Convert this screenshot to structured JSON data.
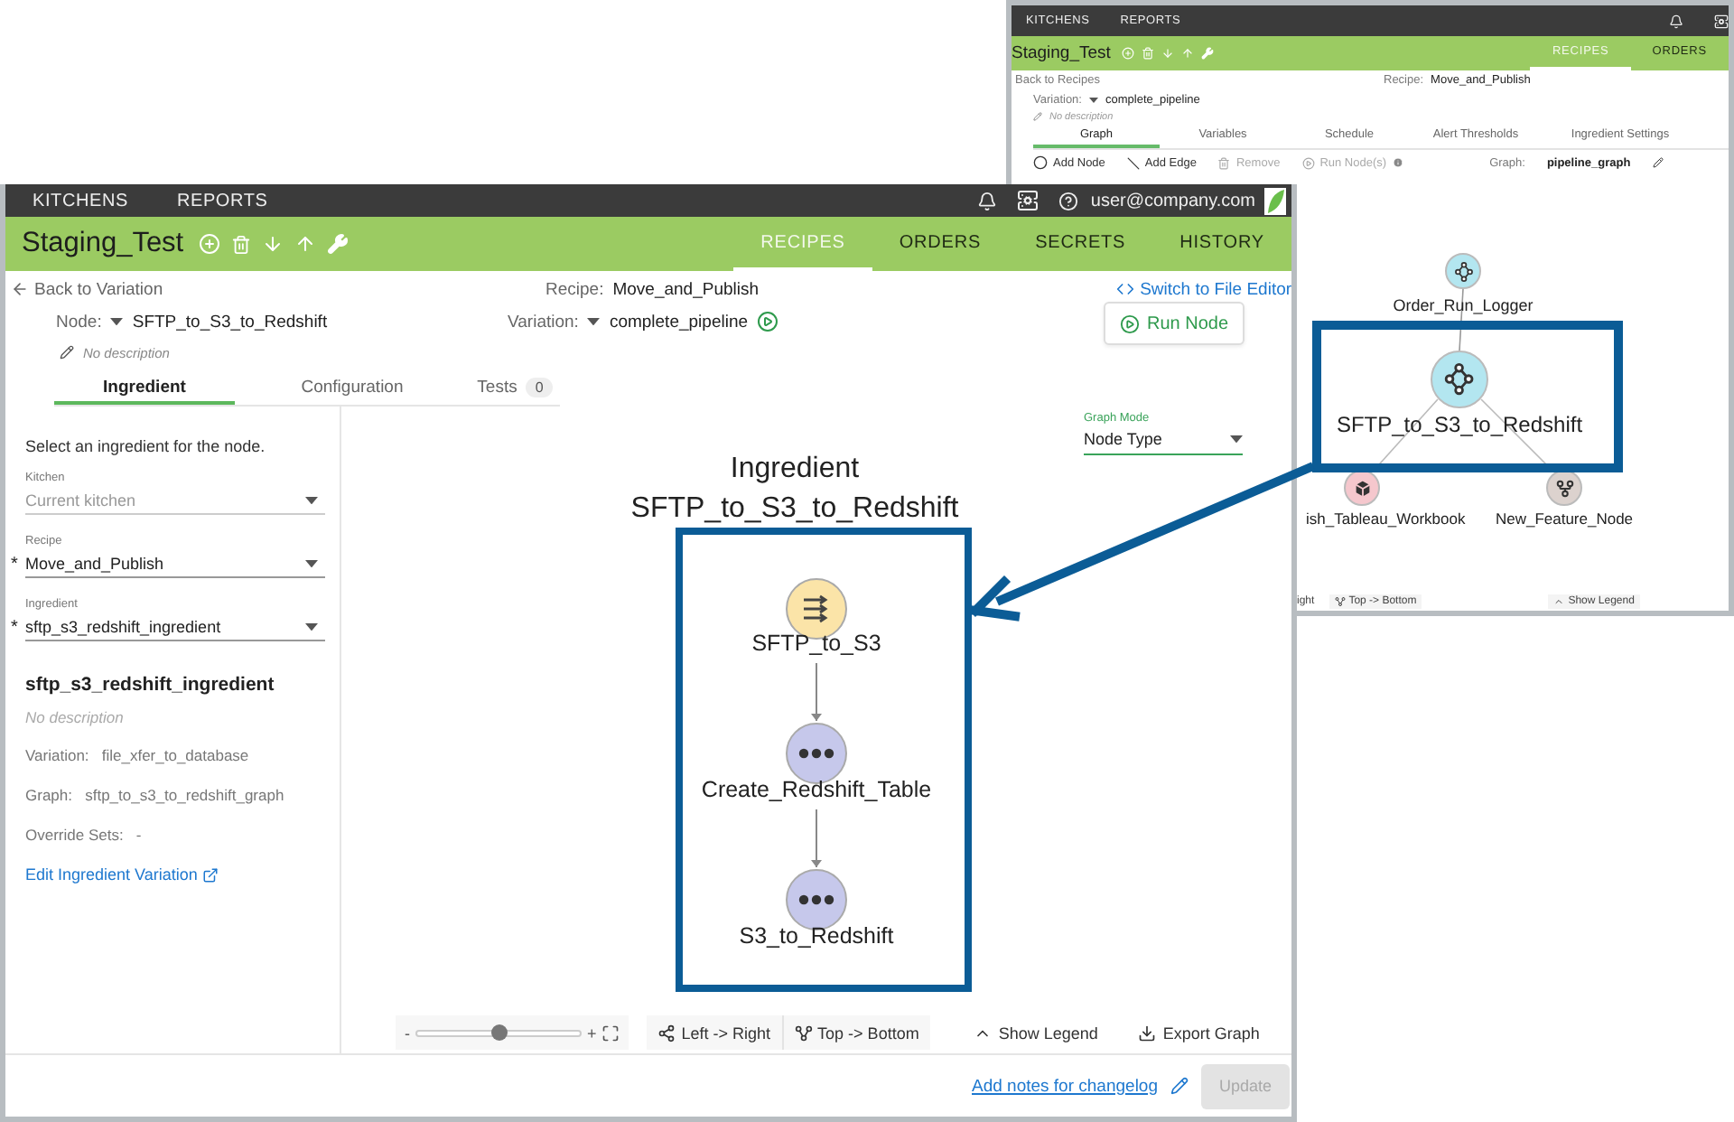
{
  "back_window": {
    "nav": {
      "items": [
        {
          "label": "KITCHENS"
        },
        {
          "label": "REPORTS"
        }
      ]
    },
    "header": {
      "title": "Staging_Test",
      "tabs": [
        {
          "label": "RECIPES",
          "selected": true
        },
        {
          "label": "ORDERS",
          "selected": false
        }
      ]
    },
    "back_link": "Back to Recipes",
    "recipe": {
      "label": "Recipe:",
      "value": "Move_and_Publish"
    },
    "variation": {
      "label": "Variation:",
      "value": "complete_pipeline"
    },
    "description": "No description",
    "tabs": [
      {
        "label": "Graph",
        "selected": true
      },
      {
        "label": "Variables",
        "selected": false
      },
      {
        "label": "Schedule",
        "selected": false
      },
      {
        "label": "Alert Thresholds",
        "selected": false
      },
      {
        "label": "Ingredient Settings",
        "selected": false
      }
    ],
    "toolbar": [
      {
        "kind": "add-node",
        "label": "Add Node",
        "disabled": false
      },
      {
        "kind": "add-edge",
        "label": "Add Edge",
        "disabled": false
      },
      {
        "kind": "remove",
        "label": "Remove",
        "disabled": true
      },
      {
        "kind": "run",
        "label": "Run Node(s)",
        "disabled": true
      }
    ],
    "graph_name": {
      "label": "Graph:",
      "value": "pipeline_graph"
    },
    "nodes": [
      {
        "label": "Order_Run_Logger",
        "color": "#b3e6f0",
        "kind": "workflow"
      },
      {
        "label": "SFTP_to_S3_to_Redshift",
        "color": "#b3e6f0",
        "kind": "workflow"
      },
      {
        "label": "ish_Tableau_Workbook",
        "color": "#f5c7cd",
        "kind": "cube"
      },
      {
        "label": "New_Feature_Node",
        "color": "#dcd2ce",
        "kind": "fork"
      }
    ],
    "bottom_toolbar": [
      {
        "kind": "text",
        "label": "ight"
      },
      {
        "kind": "top-bottom",
        "label": "Top -> Bottom"
      },
      {
        "kind": "legend",
        "label": "Show Legend"
      }
    ]
  },
  "front_window": {
    "nav": {
      "items": [
        {
          "label": "KITCHENS"
        },
        {
          "label": "REPORTS"
        }
      ],
      "user": "user@company.com"
    },
    "header": {
      "title": "Staging_Test",
      "tabs": [
        {
          "label": "RECIPES",
          "selected": true
        },
        {
          "label": "ORDERS",
          "selected": false
        },
        {
          "label": "SECRETS",
          "selected": false
        },
        {
          "label": "HISTORY",
          "selected": false
        }
      ]
    },
    "back_link": "Back to Variation",
    "recipe": {
      "label": "Recipe:",
      "value": "Move_and_Publish"
    },
    "switch_link": "Switch to File Editor",
    "node": {
      "label": "Node:",
      "value": "SFTP_to_S3_to_Redshift"
    },
    "variation": {
      "label": "Variation:",
      "value": "complete_pipeline"
    },
    "description": "No description",
    "run_button": "Run Node",
    "tabs": [
      {
        "label": "Ingredient",
        "selected": true
      },
      {
        "label": "Configuration",
        "selected": false
      },
      {
        "label": "Tests",
        "selected": false,
        "count": "0"
      }
    ],
    "sidebar": {
      "prompt": "Select an ingredient for the node.",
      "fields": [
        {
          "label": "Kitchen",
          "value": "Current kitchen",
          "disabled": true
        },
        {
          "label": "Recipe",
          "value": "Move_and_Publish",
          "disabled": false,
          "required_mark": "*"
        },
        {
          "label": "Ingredient",
          "value": "sftp_s3_redshift_ingredient",
          "disabled": false,
          "required_mark": "*"
        }
      ],
      "ingredient": {
        "title": "sftp_s3_redshift_ingredient",
        "description": "No description",
        "details": [
          {
            "label": "Variation:",
            "value": "file_xfer_to_database"
          },
          {
            "label": "Graph:",
            "value": "sftp_to_s3_to_redshift_graph"
          },
          {
            "label": "Override Sets:",
            "value": "-"
          }
        ],
        "edit_link": "Edit Ingredient Variation"
      }
    },
    "graph": {
      "mode": {
        "label": "Graph Mode",
        "value": "Node Type"
      },
      "title": [
        "Ingredient",
        "SFTP_to_S3_to_Redshift"
      ],
      "nodes": [
        {
          "label": "SFTP_to_S3",
          "color": "#fbe4a8",
          "kind": "steps"
        },
        {
          "label": "Create_Redshift_Table",
          "color": "#c6c8eb",
          "kind": "dots"
        },
        {
          "label": "S3_to_Redshift",
          "color": "#c6c8eb",
          "kind": "dots"
        }
      ]
    },
    "toolbar": {
      "zoom": {
        "minus": "-",
        "plus": "+",
        "level": 0.5
      },
      "layouts": [
        {
          "kind": "left-right",
          "label": "Left -> Right"
        },
        {
          "kind": "top-bottom",
          "label": "Top -> Bottom"
        }
      ],
      "actions": [
        {
          "kind": "legend",
          "label": "Show Legend"
        },
        {
          "kind": "export",
          "label": "Export Graph"
        }
      ]
    },
    "footer": {
      "notes_link": "Add notes for changelog",
      "update_button": {
        "label": "Update",
        "disabled": true
      }
    }
  }
}
